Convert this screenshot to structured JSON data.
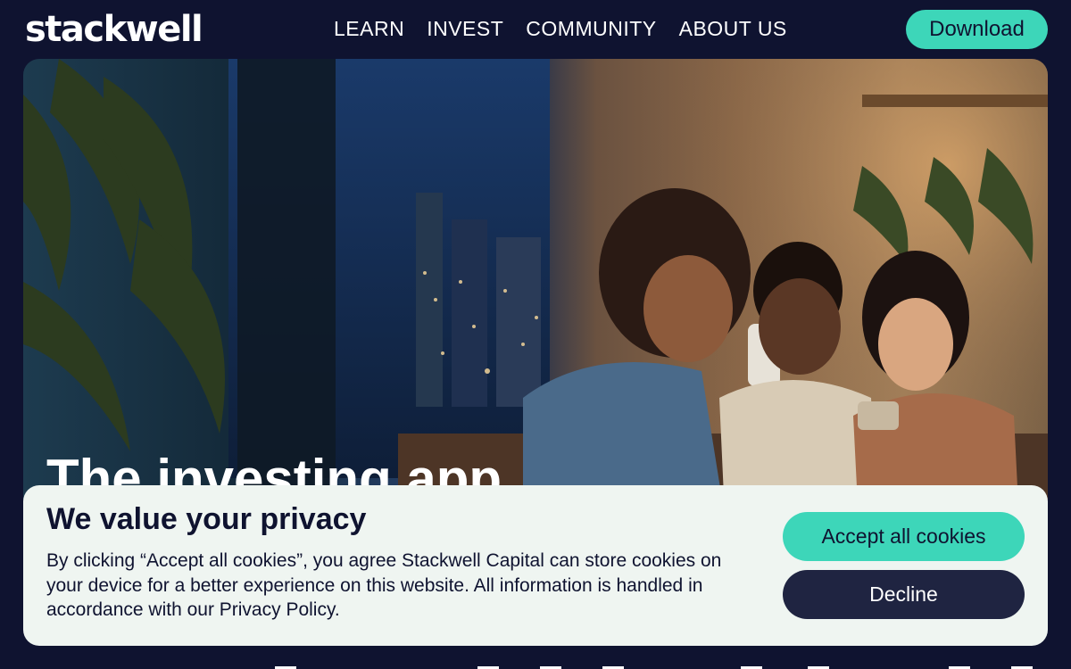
{
  "header": {
    "logo_text": "stackwell",
    "nav": [
      {
        "label": "LEARN"
      },
      {
        "label": "INVEST"
      },
      {
        "label": "COMMUNITY"
      },
      {
        "label": "ABOUT US"
      }
    ],
    "download_label": "Download"
  },
  "hero": {
    "heading": "The investing app"
  },
  "cookie_banner": {
    "title": "We value your privacy",
    "body": "By clicking “Accept all cookies”, you agree Stackwell Capital can store cookies on your device for a better experience on this website. All information is handled in accordance with our Privacy Policy.",
    "accept_label": "Accept all cookies",
    "decline_label": "Decline"
  },
  "colors": {
    "background": "#0f1330",
    "accent": "#3dd6b9",
    "banner_bg": "#eff5f1",
    "decline_bg": "#1f2441"
  }
}
